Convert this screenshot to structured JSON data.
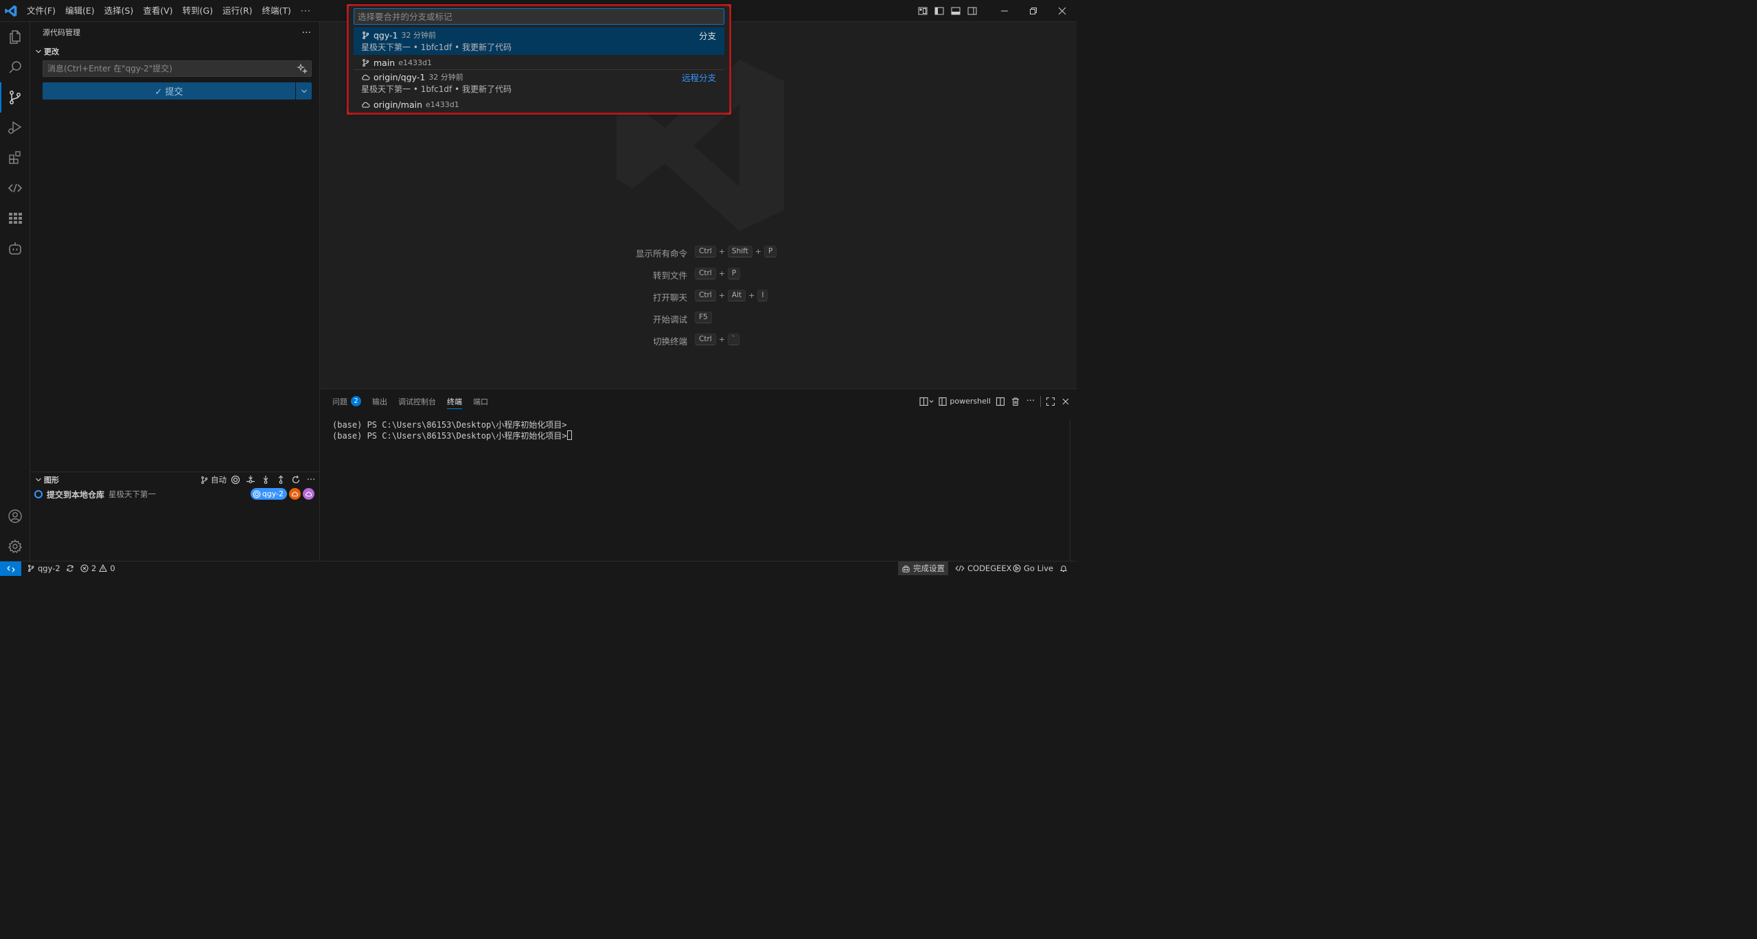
{
  "titlebar": {
    "menus": [
      "文件(F)",
      "编辑(E)",
      "选择(S)",
      "查看(V)",
      "转到(G)",
      "运行(R)",
      "终端(T)"
    ],
    "more": "···"
  },
  "sidebar": {
    "title": "源代码管理",
    "more": "···",
    "changes_header": "更改",
    "commit_placeholder": "消息(Ctrl+Enter 在\"qgy-2\"提交)",
    "commit_button": "✓ 提交",
    "graph": {
      "header": "图形",
      "auto_label": "自动",
      "commit_message": "提交到本地仓库",
      "commit_author": "星极天下第一",
      "branch_badge": "qgy-2"
    }
  },
  "quickpick": {
    "placeholder": "选择要合并的分支或标记",
    "items": [
      {
        "name": "qgy-1",
        "desc": "32 分钟前",
        "detail": "星极天下第一 • 1bfc1df • 我更新了代码",
        "group": "分支",
        "kind": "branch"
      },
      {
        "name": "main",
        "desc": "e1433d1",
        "detail": "",
        "group": "",
        "kind": "branch"
      },
      {
        "name": "origin/qgy-1",
        "desc": "32 分钟前",
        "detail": "星极天下第一 • 1bfc1df • 我更新了代码",
        "group": "远程分支",
        "kind": "remote"
      },
      {
        "name": "origin/main",
        "desc": "e1433d1",
        "detail": "",
        "group": "",
        "kind": "remote"
      }
    ]
  },
  "editor": {
    "shortcuts": [
      {
        "label": "显示所有命令",
        "keys": [
          "Ctrl",
          "Shift",
          "P"
        ]
      },
      {
        "label": "转到文件",
        "keys": [
          "Ctrl",
          "P"
        ]
      },
      {
        "label": "打开聊天",
        "keys": [
          "Ctrl",
          "Alt",
          "I"
        ]
      },
      {
        "label": "开始调试",
        "keys": [
          "F5"
        ]
      },
      {
        "label": "切换终端",
        "keys": [
          "Ctrl",
          "`"
        ]
      }
    ]
  },
  "panel": {
    "tabs": [
      {
        "label": "问题",
        "badge": "2"
      },
      {
        "label": "输出"
      },
      {
        "label": "调试控制台"
      },
      {
        "label": "终端",
        "active": true
      },
      {
        "label": "端口"
      }
    ],
    "terminal_name": "powershell",
    "lines": [
      "(base) PS C:\\Users\\86153\\Desktop\\小程序初始化项目>",
      "(base) PS C:\\Users\\86153\\Desktop\\小程序初始化项目>"
    ]
  },
  "statusbar": {
    "branch": "qgy-2",
    "errors": "2",
    "warnings": "0",
    "setup": "完成设置",
    "codegeex": "CODEGEEX",
    "golive": "Go Live"
  },
  "colors": {
    "accent": "#0078d4",
    "selection": "#04395e",
    "outline": "#e02020",
    "remote_group": "#3794ff"
  }
}
